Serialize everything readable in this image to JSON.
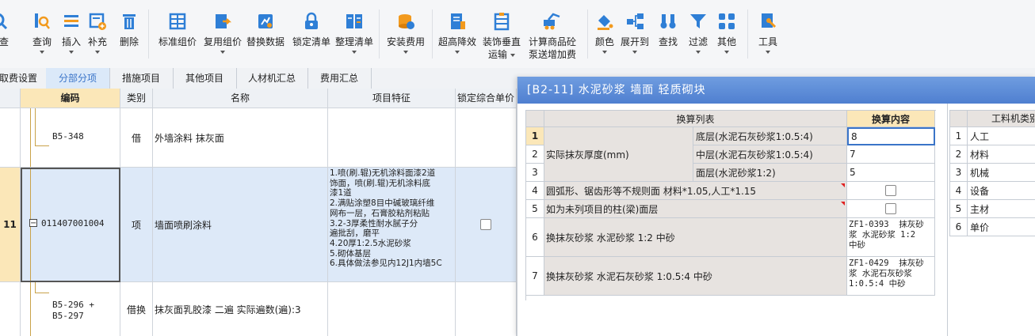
{
  "toolbar": {
    "buttons": [
      {
        "label": "检查"
      },
      {
        "label": "查询"
      },
      {
        "label": "插入"
      },
      {
        "label": "补充"
      },
      {
        "label": "删除"
      },
      {
        "label": "标准组价"
      },
      {
        "label": "复用组价"
      },
      {
        "label": "替换数据"
      },
      {
        "label": "锁定清单"
      },
      {
        "label": "整理清单"
      },
      {
        "label": "安装费用"
      },
      {
        "label": "超高降效"
      },
      {
        "label": "装饰垂直",
        "label2": "运输"
      },
      {
        "label": "计算商品砼",
        "label2": "泵送增加费"
      },
      {
        "label": "颜色"
      },
      {
        "label": "展开到"
      },
      {
        "label": "查找"
      },
      {
        "label": "过滤"
      },
      {
        "label": "其他"
      },
      {
        "label": "工具"
      }
    ]
  },
  "tabs": [
    "取费设置",
    "分部分项",
    "措施项目",
    "其他项目",
    "人材机汇总",
    "费用汇总"
  ],
  "grid": {
    "headers": [
      "编码",
      "类别",
      "名称",
      "项目特征",
      "锁定综合单价"
    ],
    "rows": [
      {
        "num": "",
        "code": "B5-348",
        "type": "借",
        "name": "外墙涂料 抹灰面",
        "features": ""
      },
      {
        "num": "11",
        "code": "011407001004",
        "type": "项",
        "name": "墙面喷刷涂料",
        "features": "1.喷(刷.辊)无机涂料面漆2道\n饰面，喷(刷.辊)无机涂料底\n漆1道\n2.满贴涂塑8目中碱玻璃纤维\n网布一层，石膏胶粘剂粘贴\n3.2-3厚柔性耐水腻子分\n遍批刮，磨平\n4.20厚1:2.5水泥砂浆\n5.砌体基层\n6.具体做法参见内12J1内墙5C"
      },
      {
        "num": "",
        "code": "B5-296 +\nB5-297",
        "type": "借换",
        "name": "抹灰面乳胶漆 二遍  实际遍数(遍):3",
        "features": ""
      }
    ]
  },
  "dialog": {
    "title": "[B2-11] 水泥砂浆 墙面 轻质砌块",
    "header_list": "换算列表",
    "header_content": "换算内容",
    "rows": [
      {
        "num": "1",
        "label": "实际抹灰厚度(mm)",
        "sub": "底层(水泥石灰砂浆1:0.5:4)",
        "value": "8"
      },
      {
        "num": "2",
        "label": "",
        "sub": "中层(水泥石灰砂浆1:0.5:4)",
        "value": "7"
      },
      {
        "num": "3",
        "label": "",
        "sub": "面层(水泥砂浆1:2)",
        "value": "5"
      },
      {
        "num": "4",
        "label": "圆弧形、锯齿形等不规则面 材料*1.05,人工*1.15",
        "sub": "",
        "value": ""
      },
      {
        "num": "5",
        "label": "如为未列项目的柱(梁)面层",
        "sub": "",
        "value": ""
      },
      {
        "num": "6",
        "label": "换抹灰砂浆 水泥砂浆 1:2 中砂",
        "sub": "",
        "value": "ZF1-0393  抹灰砂\n浆 水泥砂浆 1:2\n中砂"
      },
      {
        "num": "7",
        "label": "换抹灰砂浆 水泥石灰砂浆 1:0.5:4 中砂",
        "sub": "",
        "value": "ZF1-0429  抹灰砂\n浆 水泥石灰砂浆\n1:0.5:4 中砂"
      }
    ],
    "side_header": "工料机类别",
    "side_rows": [
      {
        "num": "1",
        "label": "人工"
      },
      {
        "num": "2",
        "label": "材料"
      },
      {
        "num": "3",
        "label": "机械"
      },
      {
        "num": "4",
        "label": "设备"
      },
      {
        "num": "5",
        "label": "主材"
      },
      {
        "num": "6",
        "label": "单价"
      }
    ]
  },
  "colors": {
    "accent": "#3a74c8",
    "title_bar": "#5a88d6",
    "highlight": "#fbe7b8",
    "selected_row": "#dde9f8"
  }
}
